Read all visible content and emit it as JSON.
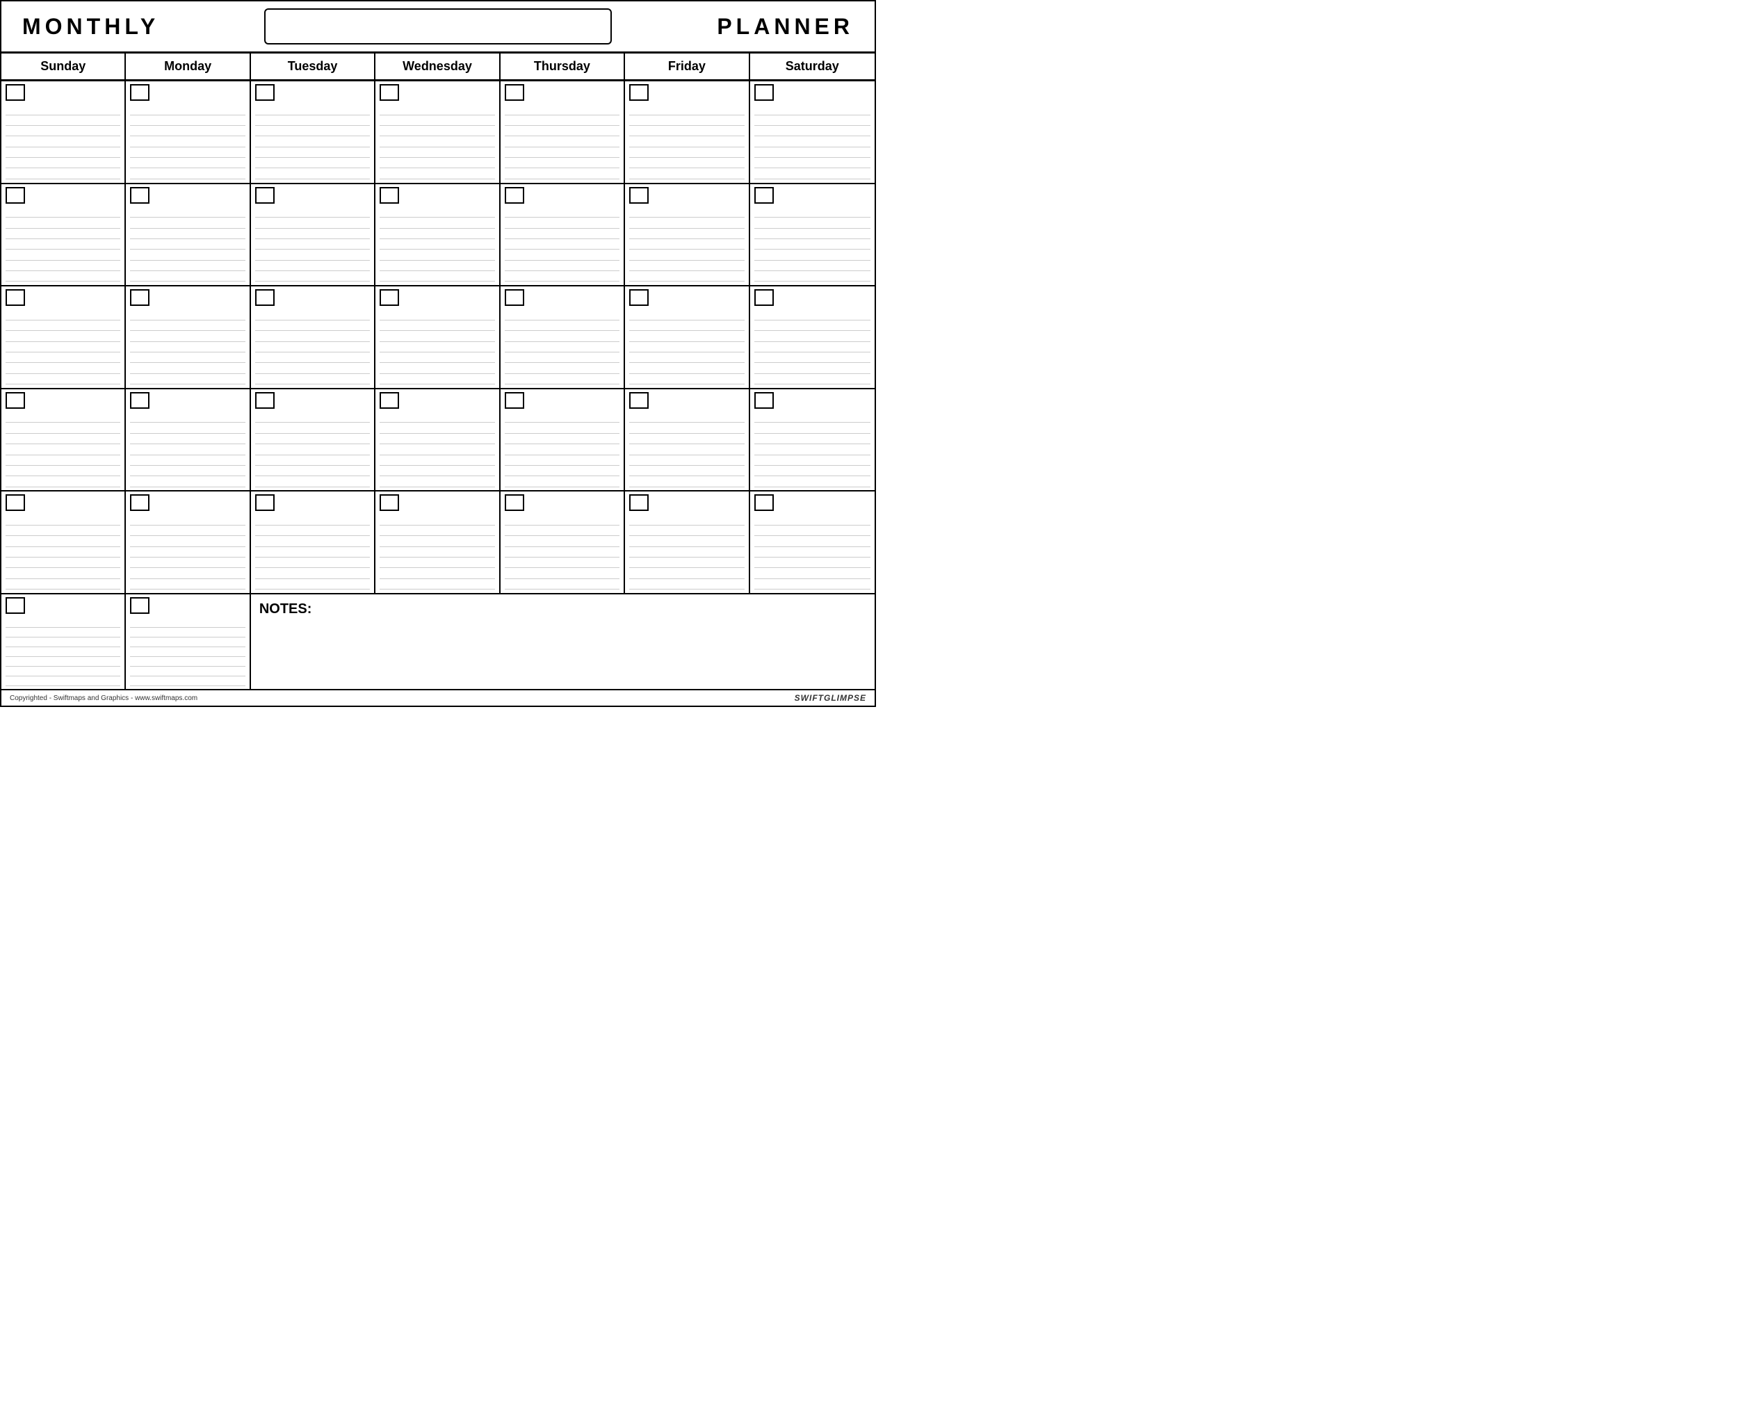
{
  "header": {
    "monthly_label": "MONTHLY",
    "planner_label": "PLANNER",
    "title_placeholder": ""
  },
  "days": {
    "headers": [
      "Sunday",
      "Monday",
      "Tuesday",
      "Wednesday",
      "Thursday",
      "Friday",
      "Saturday"
    ]
  },
  "rows": [
    {
      "cells": [
        {},
        {},
        {},
        {},
        {},
        {},
        {}
      ]
    },
    {
      "cells": [
        {},
        {},
        {},
        {},
        {},
        {},
        {}
      ]
    },
    {
      "cells": [
        {},
        {},
        {},
        {},
        {},
        {},
        {}
      ]
    },
    {
      "cells": [
        {},
        {},
        {},
        {},
        {},
        {},
        {}
      ]
    },
    {
      "cells": [
        {},
        {},
        {},
        {},
        {},
        {},
        {}
      ]
    }
  ],
  "notes_row": {
    "label": "NOTES:",
    "cells": 2
  },
  "footer": {
    "copyright": "Copyrighted - Swiftmaps and Graphics - www.swiftmaps.com",
    "brand": "SWIFT GLIMPSE"
  }
}
